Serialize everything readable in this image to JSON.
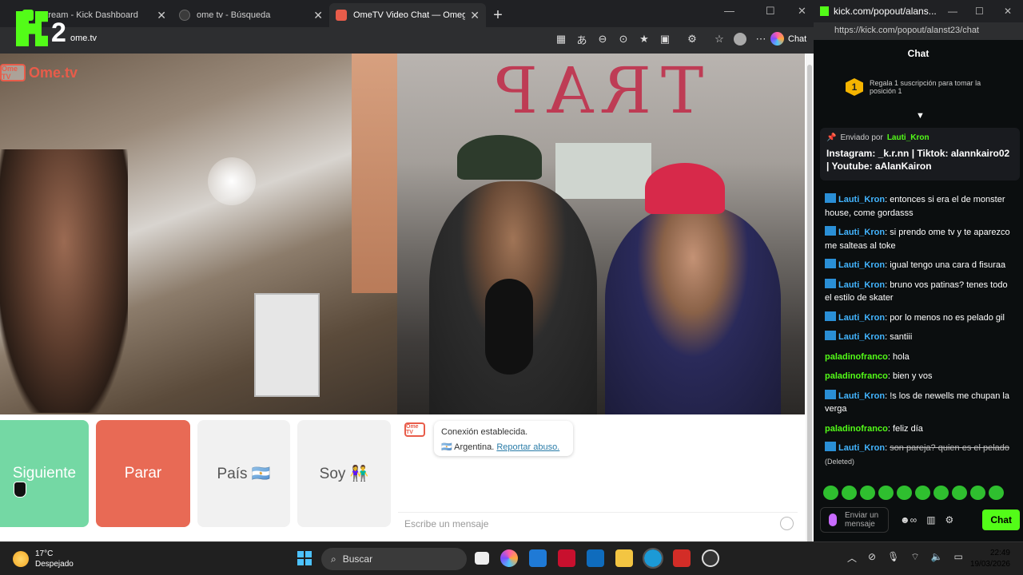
{
  "browser": {
    "tabs": [
      {
        "label": "Stream - Kick Dashboard",
        "color": "#53fc18",
        "active": false
      },
      {
        "label": "ome tv - Búsqueda",
        "color": "#3b3b3b",
        "active": false
      },
      {
        "label": "OmeTV Video Chat — Omegle",
        "color": "#e85c4a",
        "active": true
      }
    ],
    "new_tab": "+",
    "address": "ome.tv",
    "chat_button": "Chat",
    "stream_badge": "2"
  },
  "ometv": {
    "logo_box": "Ome TV",
    "logo_text": "Ome.tv",
    "wall_text": "TRAP",
    "buttons": {
      "next": "Siguiente",
      "stop": "Parar",
      "country": "País 🇦🇷",
      "gender": "Soy 👫"
    },
    "chat": {
      "icon_text": "Ome TV",
      "status": "Conexión establecida.",
      "country": "🇦🇷 Argentina.",
      "report": "Reportar abuso.",
      "placeholder": "Escribe un mensaje"
    }
  },
  "kick": {
    "window_title": "kick.com/popout/alans...",
    "url": "https://kick.com/popout/alanst23/chat",
    "chat_label": "Chat",
    "sub_num": "1",
    "sub_text": "Regala 1 suscripción para tomar la posición 1",
    "pinned": {
      "sent_by": "Enviado por",
      "user": "Lauti_Kron",
      "text": "Instagram: _k.r.nn | Tiktok: alannkairo02 | Youtube: aAlanKairon"
    },
    "messages": [
      {
        "user": "Lauti_Kron",
        "text": "entonces si era el de monster house, come gordasss",
        "badge": true
      },
      {
        "user": "Lauti_Kron",
        "text": "si prendo ome tv y te aparezco me salteas al toke",
        "badge": true
      },
      {
        "user": "Lauti_Kron",
        "text": "igual tengo una cara d fisuraa",
        "badge": true
      },
      {
        "user": "Lauti_Kron",
        "text": "bruno vos patinas? tenes todo el estilo de skater",
        "badge": true
      },
      {
        "user": "Lauti_Kron",
        "text": "por lo menos no es pelado gil",
        "badge": true
      },
      {
        "user": "Lauti_Kron",
        "text": "santiii",
        "badge": true
      },
      {
        "user": "paladinofranco",
        "text": "hola",
        "badge": false
      },
      {
        "user": "paladinofranco",
        "text": "bien y vos",
        "badge": false
      },
      {
        "user": "Lauti_Kron",
        "text": "!s los de newells me chupan la verga",
        "badge": true
      },
      {
        "user": "paladinofranco",
        "text": "feliz día",
        "badge": false
      }
    ],
    "deleted": {
      "user": "Lauti_Kron",
      "text": "son pareja? quien es el pelado",
      "tag": "(Deleted)"
    },
    "input_placeholder": "Enviar un mensaje",
    "send_button": "Chat",
    "accent": "#53fc18"
  },
  "taskbar": {
    "temp": "17°C",
    "weather": "Despejado",
    "search": "Buscar",
    "time": "22:49",
    "date": "19/03/2026"
  }
}
